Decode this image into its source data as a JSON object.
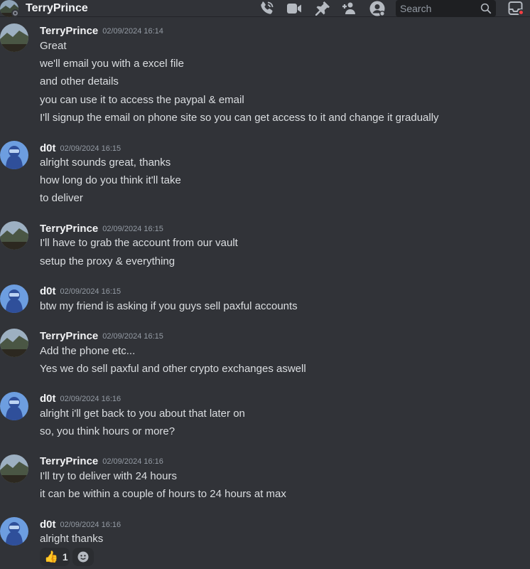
{
  "header": {
    "title": "TerryPrince",
    "search_placeholder": "Search",
    "icons": [
      "voice-call-icon",
      "video-call-icon",
      "pin-icon",
      "add-friends-icon",
      "user-profile-icon",
      "search-icon",
      "inbox-icon"
    ]
  },
  "messages": [
    {
      "author": "TerryPrince",
      "timestamp": "02/09/2024 16:14",
      "lines": [
        "Great",
        "we'll email you with a excel file",
        "and other details",
        "you can use it to access the paypal & email",
        "I'll signup the email on phone site so you can get access to it and change it gradually"
      ]
    },
    {
      "author": "d0t",
      "timestamp": "02/09/2024 16:15",
      "lines": [
        "alright sounds great, thanks",
        "how long do you think it'll take",
        "to deliver"
      ]
    },
    {
      "author": "TerryPrince",
      "timestamp": "02/09/2024 16:15",
      "lines": [
        "I'll have to grab the account from our vault",
        "setup the proxy & everything"
      ]
    },
    {
      "author": "d0t",
      "timestamp": "02/09/2024 16:15",
      "lines": [
        "btw my friend is asking if you guys sell paxful accounts"
      ]
    },
    {
      "author": "TerryPrince",
      "timestamp": "02/09/2024 16:15",
      "lines": [
        "Add the phone etc...",
        "Yes we do sell paxful and other crypto exchanges aswell"
      ]
    },
    {
      "author": "d0t",
      "timestamp": "02/09/2024 16:16",
      "lines": [
        "alright i'll get back to you about that later on",
        "so, you think hours or more?"
      ]
    },
    {
      "author": "TerryPrince",
      "timestamp": "02/09/2024 16:16",
      "lines": [
        "I'll try to deliver with 24 hours",
        "it can be within a couple of hours to 24 hours at max"
      ]
    },
    {
      "author": "d0t",
      "timestamp": "02/09/2024 16:16",
      "lines": [
        "alright thanks"
      ]
    }
  ],
  "reactions": [
    {
      "emoji": "👍",
      "count": "1"
    },
    {
      "icon": "add-reaction-icon"
    }
  ],
  "colors": {
    "background": "#313338",
    "text": "#dbdee1",
    "timestamp": "#949ba4",
    "d0t_avatar": "#4e7cc9"
  }
}
